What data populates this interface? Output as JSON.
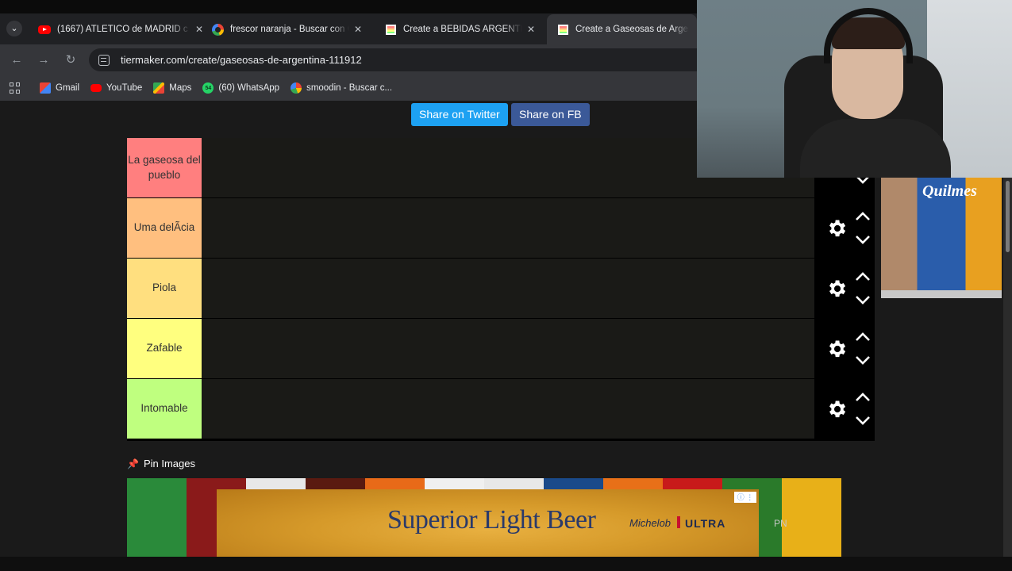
{
  "browser": {
    "tabs": [
      {
        "title": "(1667) ATLÉTICO de MADRID c",
        "favicon": "youtube-icon",
        "active": false
      },
      {
        "title": "frescor naranja - Buscar con G",
        "favicon": "google-icon",
        "active": false
      },
      {
        "title": "Create a BEBIDAS ARGENTINA",
        "favicon": "tiermaker-icon",
        "active": false
      },
      {
        "title": "Create a Gaseosas de Argenti",
        "favicon": "tiermaker-icon",
        "active": true
      }
    ],
    "url": "tiermaker.com/create/gaseosas-de-argentina-111912",
    "bookmarks": [
      {
        "label": "Gmail",
        "icon": "gmail-icon"
      },
      {
        "label": "YouTube",
        "icon": "youtube-icon"
      },
      {
        "label": "Maps",
        "icon": "maps-icon"
      },
      {
        "label": "(60) WhatsApp",
        "icon": "whatsapp-icon",
        "badge": "54"
      },
      {
        "label": "smoodin - Buscar c...",
        "icon": "google-icon"
      }
    ]
  },
  "share": {
    "twitter_label": "Share on Twitter",
    "fb_label": "Share on FB"
  },
  "tiers": [
    {
      "label": "La gaseosa del pueblo",
      "color": "#ff7f7f"
    },
    {
      "label": "Uma delÃcia",
      "color": "#ffbf7f"
    },
    {
      "label": "Piola",
      "color": "#ffdf7f"
    },
    {
      "label": "Zafable",
      "color": "#ffff7f"
    },
    {
      "label": "Intomable",
      "color": "#bfff7f"
    }
  ],
  "pin_images_label": "Pin Images",
  "ad": {
    "headline": "Superior Light Beer",
    "brand": "Michelob",
    "ultra": "ULTRA",
    "side_text": "PN",
    "side_ad_text": "Quilmes"
  }
}
